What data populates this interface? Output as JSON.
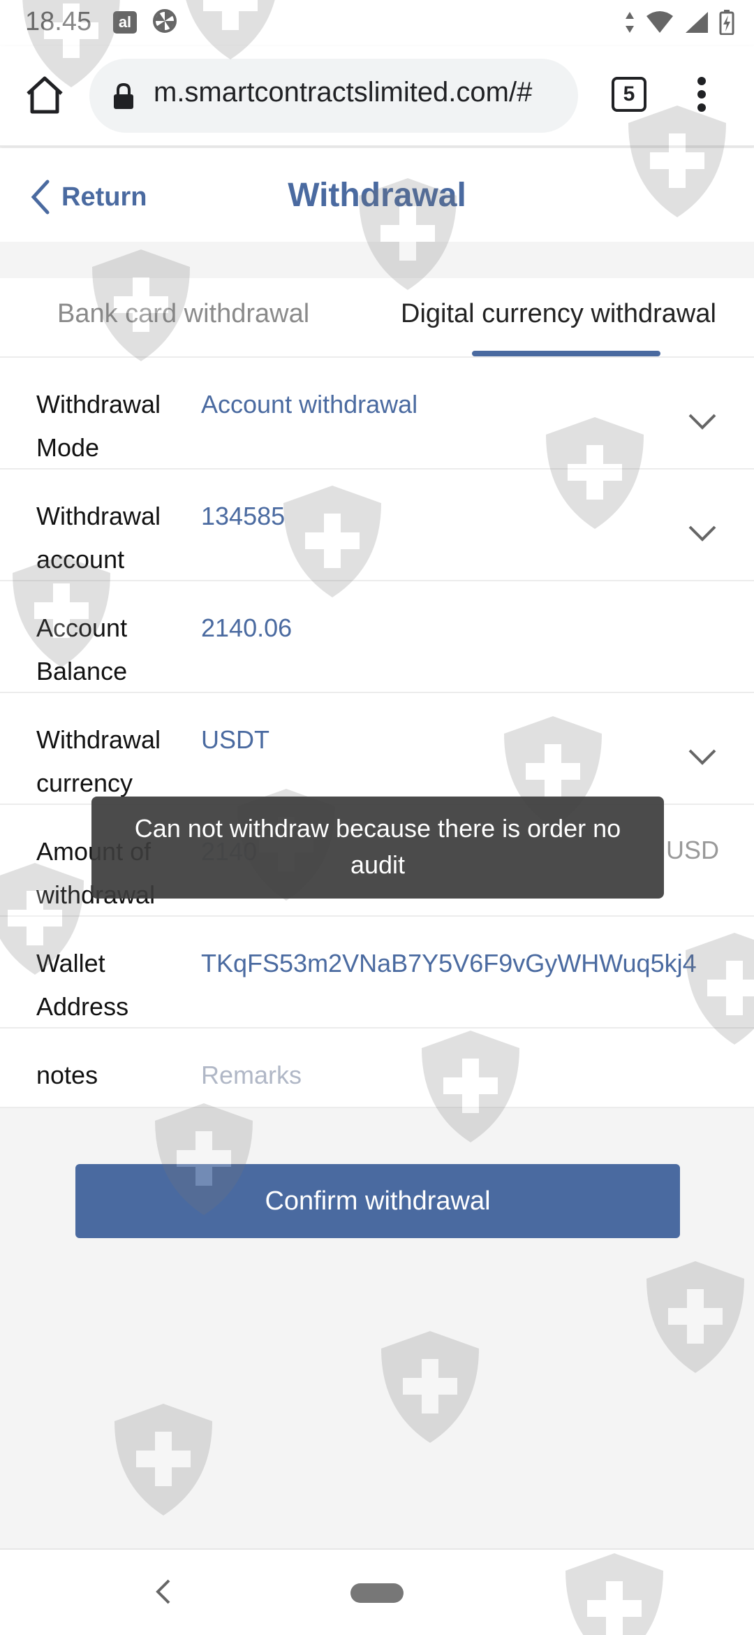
{
  "status_bar": {
    "time": "18.45",
    "app_icon_text": "al"
  },
  "browser": {
    "url": "m.smartcontractslimited.com/#",
    "tabs_count": "5"
  },
  "header": {
    "return_label": "Return",
    "title": "Withdrawal"
  },
  "tabs": [
    {
      "label": "Bank card withdrawal",
      "active": false
    },
    {
      "label": "Digital currency withdrawal",
      "active": true
    }
  ],
  "form": {
    "withdrawal_mode": {
      "label": "Withdrawal Mode",
      "value": "Account withdrawal"
    },
    "withdrawal_account": {
      "label": "Withdrawal account",
      "value": "134585"
    },
    "account_balance": {
      "label": "Account Balance",
      "value": "2140.06"
    },
    "withdrawal_currency": {
      "label": "Withdrawal currency",
      "value": "USDT"
    },
    "amount": {
      "label": "Amount of withdrawal",
      "value": "2140",
      "suffix": "USD"
    },
    "wallet_address": {
      "label": "Wallet Address",
      "value": "TKqFS53m2VNaB7Y5V6F9vGyWHWuq5kj4"
    },
    "notes": {
      "label": "notes",
      "placeholder": "Remarks"
    }
  },
  "confirm_button": "Confirm withdrawal",
  "toast": "Can not withdraw because there is order no audit",
  "colors": {
    "accent": "#4a6aa0",
    "toast_bg": "#3c3c3c",
    "background": "#f4f4f4"
  }
}
